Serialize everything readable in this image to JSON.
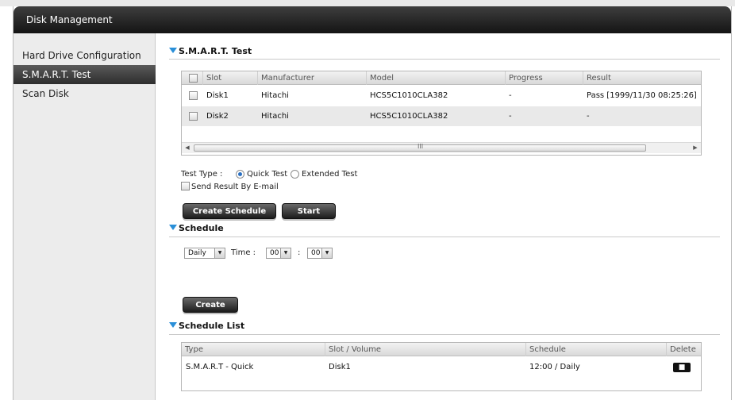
{
  "window": {
    "title": "Disk Management"
  },
  "sidebar": {
    "items": [
      {
        "label": "Hard Drive Configuration",
        "active": false
      },
      {
        "label": "S.M.A.R.T. Test",
        "active": true
      },
      {
        "label": "Scan Disk",
        "active": false
      }
    ]
  },
  "smart": {
    "heading": "S.M.A.R.T. Test",
    "columns": [
      "Slot",
      "Manufacturer",
      "Model",
      "Progress",
      "Result"
    ],
    "rows": [
      {
        "slot": "Disk1",
        "manufacturer": "Hitachi",
        "model": "HCS5C1010CLA382",
        "progress": "-",
        "result": "Pass [1999/11/30 08:25:26]"
      },
      {
        "slot": "Disk2",
        "manufacturer": "Hitachi",
        "model": "HCS5C1010CLA382",
        "progress": "-",
        "result": "-"
      }
    ],
    "scroll_grip": "III",
    "test_type_label": "Test Type :",
    "quick_label": "Quick Test",
    "extended_label": "Extended Test",
    "selected_test": "Quick Test",
    "email_label": "Send Result By E-mail",
    "create_schedule_label": "Create Schedule",
    "start_label": "Start"
  },
  "schedule": {
    "heading": "Schedule",
    "frequency": "Daily",
    "time_label": "Time :",
    "hour": "00",
    "separator": ":",
    "minute": "00",
    "create_label": "Create"
  },
  "schedule_list": {
    "heading": "Schedule List",
    "columns": [
      "Type",
      "Slot / Volume",
      "Schedule",
      "Delete"
    ],
    "rows": [
      {
        "type": "S.M.A.R.T - Quick",
        "slot": "Disk1",
        "schedule": "12:00 / Daily"
      }
    ]
  },
  "colors": {
    "accent": "#2a8fd8",
    "titlebar": "#1e1e1e",
    "active_nav": "#3a3a3a"
  },
  "icons": [
    "checkbox",
    "radio",
    "dropdown-arrow-icon",
    "trash-icon",
    "triangle-down-icon",
    "scroll-left-icon",
    "scroll-right-icon"
  ]
}
